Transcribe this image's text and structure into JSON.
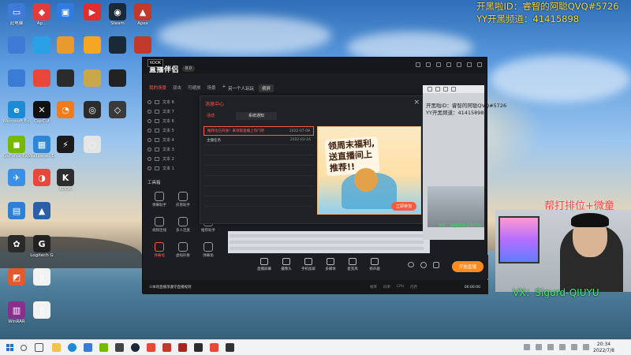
{
  "overlay": {
    "stream_id": "开黑啦ID：睿智的阿聪QVQ#5726",
    "stream_channel": "YY开黑频道：41415898",
    "help_rank": "帮打排位+微童",
    "vx": "VX：Sigurd-QIUYU"
  },
  "desktop_icons": [
    {
      "label": "此电脑",
      "color": "#3d7bd6",
      "glyph": "▭"
    },
    {
      "label": "Ap...",
      "color": "#e23b3b",
      "glyph": "◆"
    },
    {
      "label": "",
      "color": "#2f7be0",
      "glyph": "▣"
    },
    {
      "label": "",
      "color": "#e02d2d",
      "glyph": "▶"
    },
    {
      "label": "Steam",
      "color": "#1b2838",
      "glyph": "◉"
    },
    {
      "label": "Apex",
      "color": "#c0392b",
      "glyph": "▲"
    }
  ],
  "desktop_icons_b": [
    {
      "label": "Microsoft Edge",
      "color": "#1c8bd6",
      "glyph": "e"
    },
    {
      "label": "CapCut",
      "color": "#111111",
      "glyph": "✕"
    },
    {
      "label": "",
      "color": "#f07b1c",
      "glyph": "◔"
    },
    {
      "label": "",
      "color": "#2b2b2b",
      "glyph": "◎"
    },
    {
      "label": "",
      "color": "#3a3a3a",
      "glyph": "◇"
    }
  ],
  "desktop_icons_c": [
    {
      "label": "GeForce Experience",
      "color": "#76b900",
      "glyph": "◼"
    },
    {
      "label": "Wallpaper Engine",
      "color": "#2f86d6",
      "glyph": "▦"
    },
    {
      "label": "",
      "color": "#1b1b1b",
      "glyph": "⚡"
    },
    {
      "label": "",
      "color": "#e5e5e5",
      "glyph": "◌"
    }
  ],
  "desktop_icons_d": [
    {
      "label": "",
      "color": "#3a8fe6",
      "glyph": "✈"
    },
    {
      "label": "",
      "color": "#e8473a",
      "glyph": "◑"
    },
    {
      "label": "KOOK",
      "color": "#2d2d2d",
      "glyph": "K"
    }
  ],
  "desktop_icons_e": [
    {
      "label": "",
      "color": "#2f7fd6",
      "glyph": "▤"
    },
    {
      "label": "",
      "color": "#2d5fa8",
      "glyph": "▲"
    }
  ],
  "desktop_icons_f": [
    {
      "label": "",
      "color": "#2a2a2a",
      "glyph": "✿"
    },
    {
      "label": "Logitech G",
      "color": "#222222",
      "glyph": "G"
    },
    {
      "label": "",
      "color": "#e25a2d",
      "glyph": "◩"
    },
    {
      "label": "",
      "color": "#f2f2f2",
      "glyph": "▯"
    },
    {
      "label": "WinRAR",
      "color": "#8b2f8f",
      "glyph": "▥"
    },
    {
      "label": "",
      "color": "#f2f2f2",
      "glyph": "▯"
    }
  ],
  "app": {
    "badge": "KOOK",
    "name": "直播伴侣",
    "version": "8.0",
    "tabs": [
      "我的场景",
      "双击",
      "可缩放",
      "场景"
    ],
    "scene_name": "另一个人玩玩",
    "scene_mode": "横屏",
    "sources": [
      "文本 8",
      "文本 7",
      "文本 6",
      "文本 5",
      "文本 4",
      "文本 3",
      "文本 2",
      "文本 1"
    ],
    "tools_title": "工具箱",
    "tools": [
      {
        "label": "弹幕助手"
      },
      {
        "label": "房管助手"
      },
      {
        "label": "视频连线"
      },
      {
        "label": "多人连麦"
      },
      {
        "label": "推荐助手"
      },
      {
        "label": "弹幕墙"
      },
      {
        "label": "虚拟形象"
      },
      {
        "label": "弹幕角"
      }
    ],
    "bottom": [
      {
        "label": "直播屏幕"
      },
      {
        "label": "摄像头"
      },
      {
        "label": "手机投屏"
      },
      {
        "label": "多媒体"
      },
      {
        "label": "麦克风"
      },
      {
        "label": "扬声器"
      }
    ],
    "start_live": "开始直播",
    "notice": "①本场直播须遵守直播规则",
    "stats": [
      "帧率",
      "码率",
      "CPU",
      "内存"
    ],
    "timer": "00:00:00"
  },
  "modal": {
    "title": "消息中心",
    "tab_activity": "活动",
    "tab_system": "系统通知",
    "close": "×",
    "items": [
      {
        "title": "推荐位已开放！来领取直播上热门吧",
        "date": "2022-07-08"
      },
      {
        "title": "主播任务",
        "date": "2022-03-16"
      }
    ]
  },
  "banner": {
    "headline_1": "领周末福利,",
    "headline_2": "送直播间上",
    "headline_3": "推荐!!",
    "button": "立即参加"
  },
  "win2": {
    "id": "开黑啦ID：睿智的阿聪QVQ#5726",
    "channel": "YY开黑频道：41415898",
    "vx": "VX：Sigurd-QIUYU"
  },
  "taskbar": {
    "time": "20:34",
    "date": "2022/7/8"
  }
}
